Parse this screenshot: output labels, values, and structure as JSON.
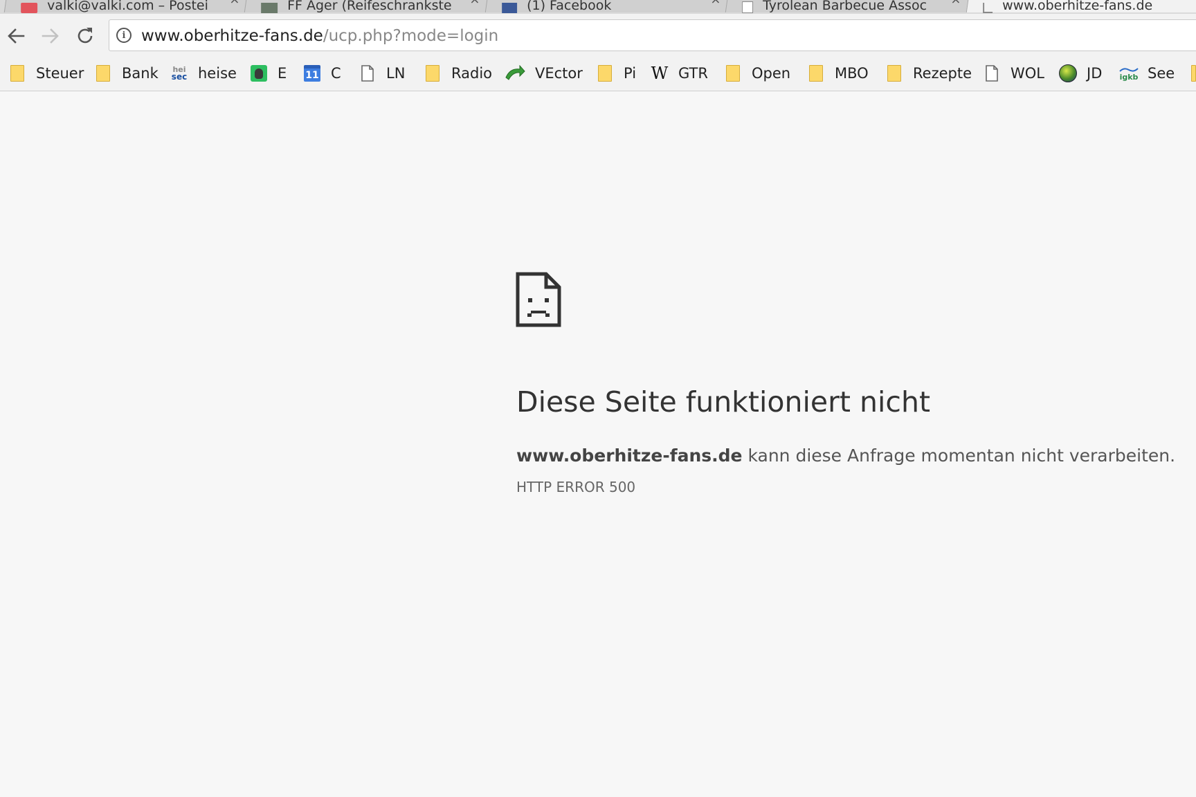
{
  "tabs": [
    {
      "title": "valki@valki.com – Postei",
      "close": "×"
    },
    {
      "title": "FF Ager (Reifeschrankste",
      "close": "×"
    },
    {
      "title": "(1) Facebook",
      "close": "×"
    },
    {
      "title": "Tyrolean Barbecue Assoc",
      "close": "×"
    },
    {
      "title": "www.oberhitze-fans.de",
      "close": "×"
    }
  ],
  "address_bar": {
    "host": "www.oberhitze-fans.de",
    "path": "/ucp.php?mode=login"
  },
  "bookmarks": [
    {
      "label": "Steuer",
      "icon": "folder-icon"
    },
    {
      "label": "Bank",
      "icon": "folder-icon"
    },
    {
      "label": "heise",
      "icon": "heise-sec-icon"
    },
    {
      "label": "E",
      "icon": "evernote-icon"
    },
    {
      "label": "C",
      "icon": "calendar-icon"
    },
    {
      "label": "LN",
      "icon": "page-icon"
    },
    {
      "label": "Radio",
      "icon": "folder-icon"
    },
    {
      "label": "VEctor",
      "icon": "vector-icon"
    },
    {
      "label": "Pi",
      "icon": "folder-icon"
    },
    {
      "label": "GTR",
      "icon": "wikipedia-icon"
    },
    {
      "label": "Open",
      "icon": "folder-icon"
    },
    {
      "label": "MBO",
      "icon": "folder-icon"
    },
    {
      "label": "Rezepte",
      "icon": "folder-icon"
    },
    {
      "label": "WOL",
      "icon": "page-icon"
    },
    {
      "label": "JD",
      "icon": "globe-icon"
    },
    {
      "label": "See",
      "icon": "igkb-icon"
    }
  ],
  "bookmark_icon_text": {
    "heise_top": "hei",
    "heise_bottom": "sec",
    "calendar_day": "11",
    "wikipedia": "W",
    "igkb": "igkb"
  },
  "error": {
    "title": "Diese Seite funktioniert nicht",
    "host": "www.oberhitze-fans.de",
    "message": " kann diese Anfrage momentan nicht verarbeiten.",
    "code": "HTTP ERROR 500"
  },
  "colors": {
    "page_background": "#f7f7f7",
    "folder": "#fcd86a",
    "calendar_blue": "#3d7de0",
    "evernote_green": "#2dbe60"
  }
}
